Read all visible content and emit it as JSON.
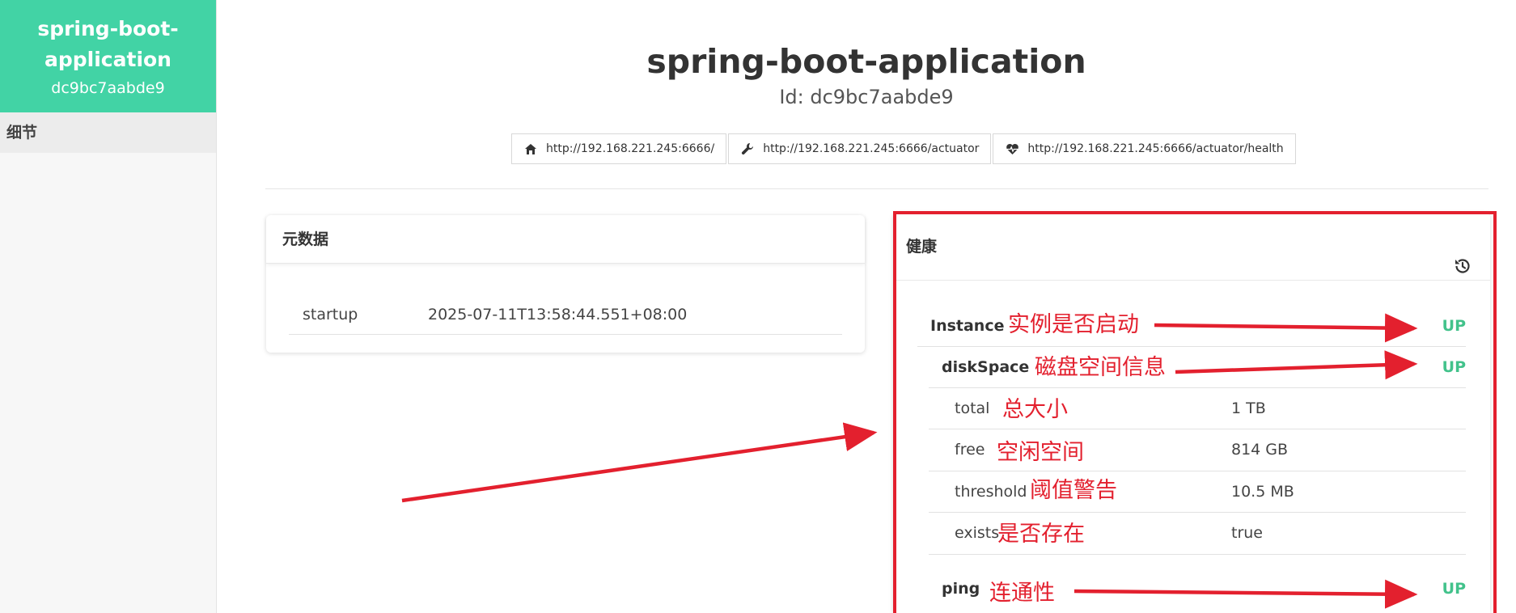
{
  "sidebar": {
    "app_name": "spring-boot-application",
    "instance_id": "dc9bc7aabde9",
    "items": [
      {
        "label": "细节"
      }
    ]
  },
  "header": {
    "title": "spring-boot-application",
    "id_label": "Id: dc9bc7aabde9"
  },
  "links": [
    {
      "icon": "home-icon",
      "url": "http://192.168.221.245:6666/"
    },
    {
      "icon": "wrench-icon",
      "url": "http://192.168.221.245:6666/actuator"
    },
    {
      "icon": "heartbeat-icon",
      "url": "http://192.168.221.245:6666/actuator/health"
    }
  ],
  "metadata": {
    "title": "元数据",
    "rows": [
      {
        "key": "startup",
        "value": "2025-07-11T13:58:44.551+08:00"
      }
    ]
  },
  "health": {
    "title": "健康",
    "instance": {
      "key": "Instance",
      "status": "UP"
    },
    "diskspace": {
      "key": "diskSpace",
      "status": "UP"
    },
    "details": [
      {
        "key": "total",
        "value": "1 TB"
      },
      {
        "key": "free",
        "value": "814 GB"
      },
      {
        "key": "threshold",
        "value": "10.5 MB"
      },
      {
        "key": "exists",
        "value": "true"
      }
    ],
    "ping": {
      "key": "ping",
      "status": "UP"
    }
  },
  "annotations": {
    "instance": "实例是否启动",
    "diskspace": "磁盘空间信息",
    "total": "总大小",
    "free": "空闲空间",
    "threshold": "阈值警告",
    "exists": "是否存在",
    "ping": "连通性"
  },
  "colors": {
    "brand": "#42d3a5",
    "status_up": "#42c28b",
    "annotation": "#e3202e"
  }
}
